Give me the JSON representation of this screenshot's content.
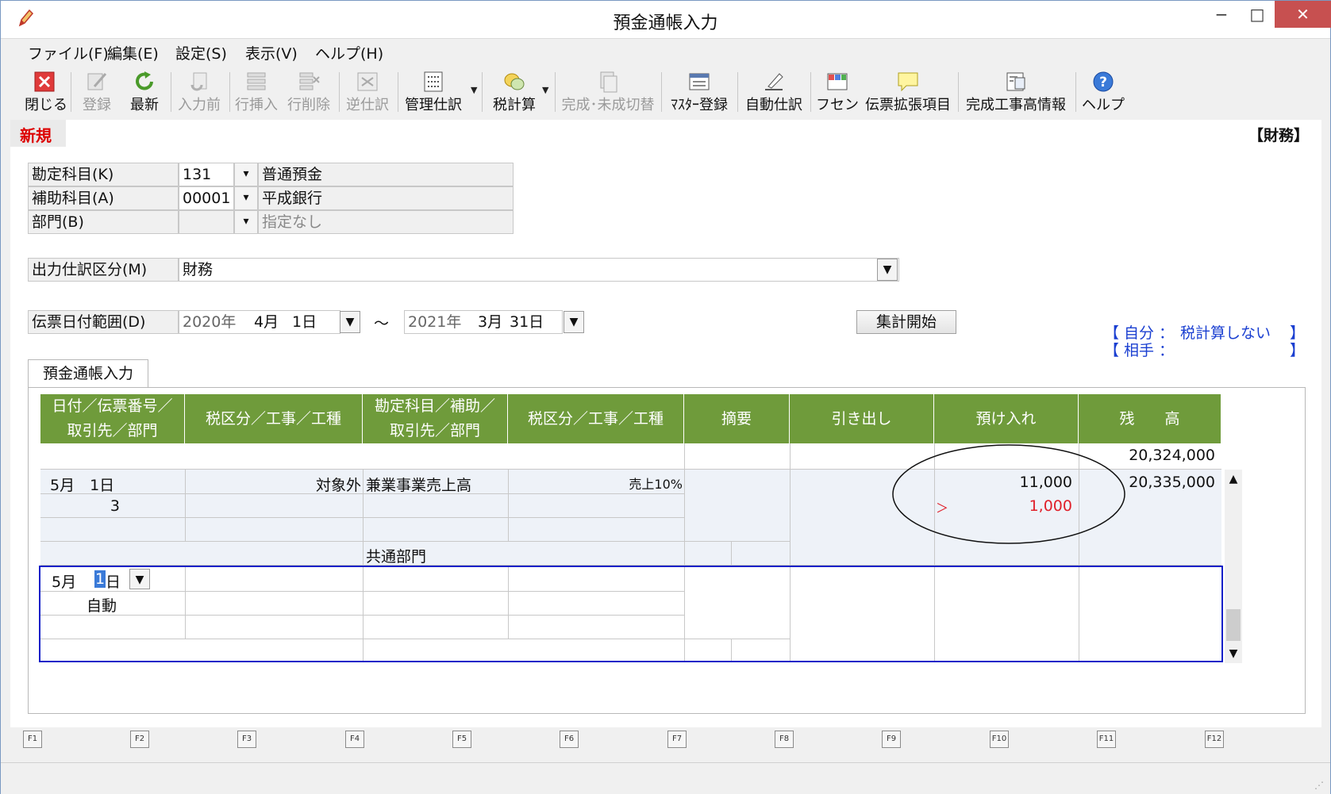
{
  "window": {
    "title": "預金通帳入力",
    "controls": {
      "minimize": "−",
      "maximize": "□",
      "close": "✕"
    }
  },
  "menu": [
    "ファイル(F)",
    "編集(E)",
    "設定(S)",
    "表示(V)",
    "ヘルプ(H)"
  ],
  "toolbar": [
    {
      "label": "閉じる",
      "icon": "close-x-icon",
      "enabled": true
    },
    {
      "label": "登録",
      "icon": "register-pencil-icon",
      "enabled": false
    },
    {
      "label": "最新",
      "icon": "refresh-icon",
      "enabled": true
    },
    {
      "label": "入力前",
      "icon": "undo-icon",
      "enabled": false
    },
    {
      "label": "行挿入",
      "icon": "insert-row-icon",
      "enabled": false
    },
    {
      "label": "行削除",
      "icon": "delete-row-icon",
      "enabled": false
    },
    {
      "label": "逆仕訳",
      "icon": "reverse-icon",
      "enabled": false
    },
    {
      "label": "管理仕訳",
      "icon": "checklist-icon",
      "enabled": true
    },
    {
      "label": "税計算",
      "icon": "tax-coins-icon",
      "enabled": true
    },
    {
      "label": "完成･未成切替",
      "icon": "switch-icon",
      "enabled": false
    },
    {
      "label": "ﾏｽﾀｰ登録",
      "icon": "master-form-icon",
      "enabled": true
    },
    {
      "label": "自動仕訳",
      "icon": "auto-pen-icon",
      "enabled": true
    },
    {
      "label": "フセン",
      "icon": "sticky-tabs-icon",
      "enabled": true
    },
    {
      "label": "伝票拡張項目",
      "icon": "speech-note-icon",
      "enabled": true
    },
    {
      "label": "完成工事高情報",
      "icon": "construction-info-icon",
      "enabled": true
    },
    {
      "label": "ヘルプ",
      "icon": "help-icon",
      "enabled": true
    }
  ],
  "mode": {
    "label": "新規",
    "right": "【財務】"
  },
  "form": {
    "account": {
      "label": "勘定科目(K)",
      "code": "131",
      "name": "普通預金"
    },
    "sub_account": {
      "label": "補助科目(A)",
      "code": "00001",
      "name": "平成銀行"
    },
    "department": {
      "label": "部門(B)",
      "code": "",
      "name": "指定なし"
    },
    "output_class": {
      "label": "出力仕訳区分(M)",
      "value": "財務"
    },
    "date_range": {
      "label": "伝票日付範囲(D)",
      "from": {
        "year": "2020年",
        "month": "4月",
        "day": "1日"
      },
      "sep": "～",
      "to": {
        "year": "2021年",
        "month": "3月",
        "day": "31日"
      }
    },
    "calc_button": "集計開始",
    "tax_info": {
      "self_prefix": "【 自分 ：",
      "self_value": "税計算しない",
      "self_suffix": "】",
      "other_prefix": "【 相手 ：",
      "other_suffix": "】"
    }
  },
  "tab": {
    "label": "預金通帳入力"
  },
  "grid": {
    "headers": [
      "日付／伝票番号／\n取引先／部門",
      "税区分／工事／工種",
      "勘定科目／補助／\n取引先／部門",
      "税区分／工事／工種",
      "摘要",
      "引き出し",
      "預け入れ",
      "残　　高"
    ],
    "opening_balance": "20,324,000",
    "rows": [
      {
        "date": "5月　1日",
        "voucher_no": "3",
        "tax_class_left": "対象外",
        "account": "兼業事業売上高",
        "tax_class_right": "売上10%",
        "department": "共通部門",
        "deposit": "11,000",
        "tax_mark": "＞",
        "tax_amount": "1,000",
        "balance": "20,335,000"
      }
    ],
    "input_row": {
      "month": "5月",
      "cursor": "1",
      "day_suffix": "日",
      "mode": "自動"
    }
  },
  "fkeys": [
    "F1",
    "F2",
    "F3",
    "F4",
    "F5",
    "F6",
    "F7",
    "F8",
    "F9",
    "F10",
    "F11",
    "F12"
  ],
  "colors": {
    "header_green": "#6f9b3b",
    "mode_red": "#d00000",
    "tax_info_blue": "#1a3fd1",
    "input_row_border": "#1020c8",
    "negative_red": "#e0202a"
  }
}
